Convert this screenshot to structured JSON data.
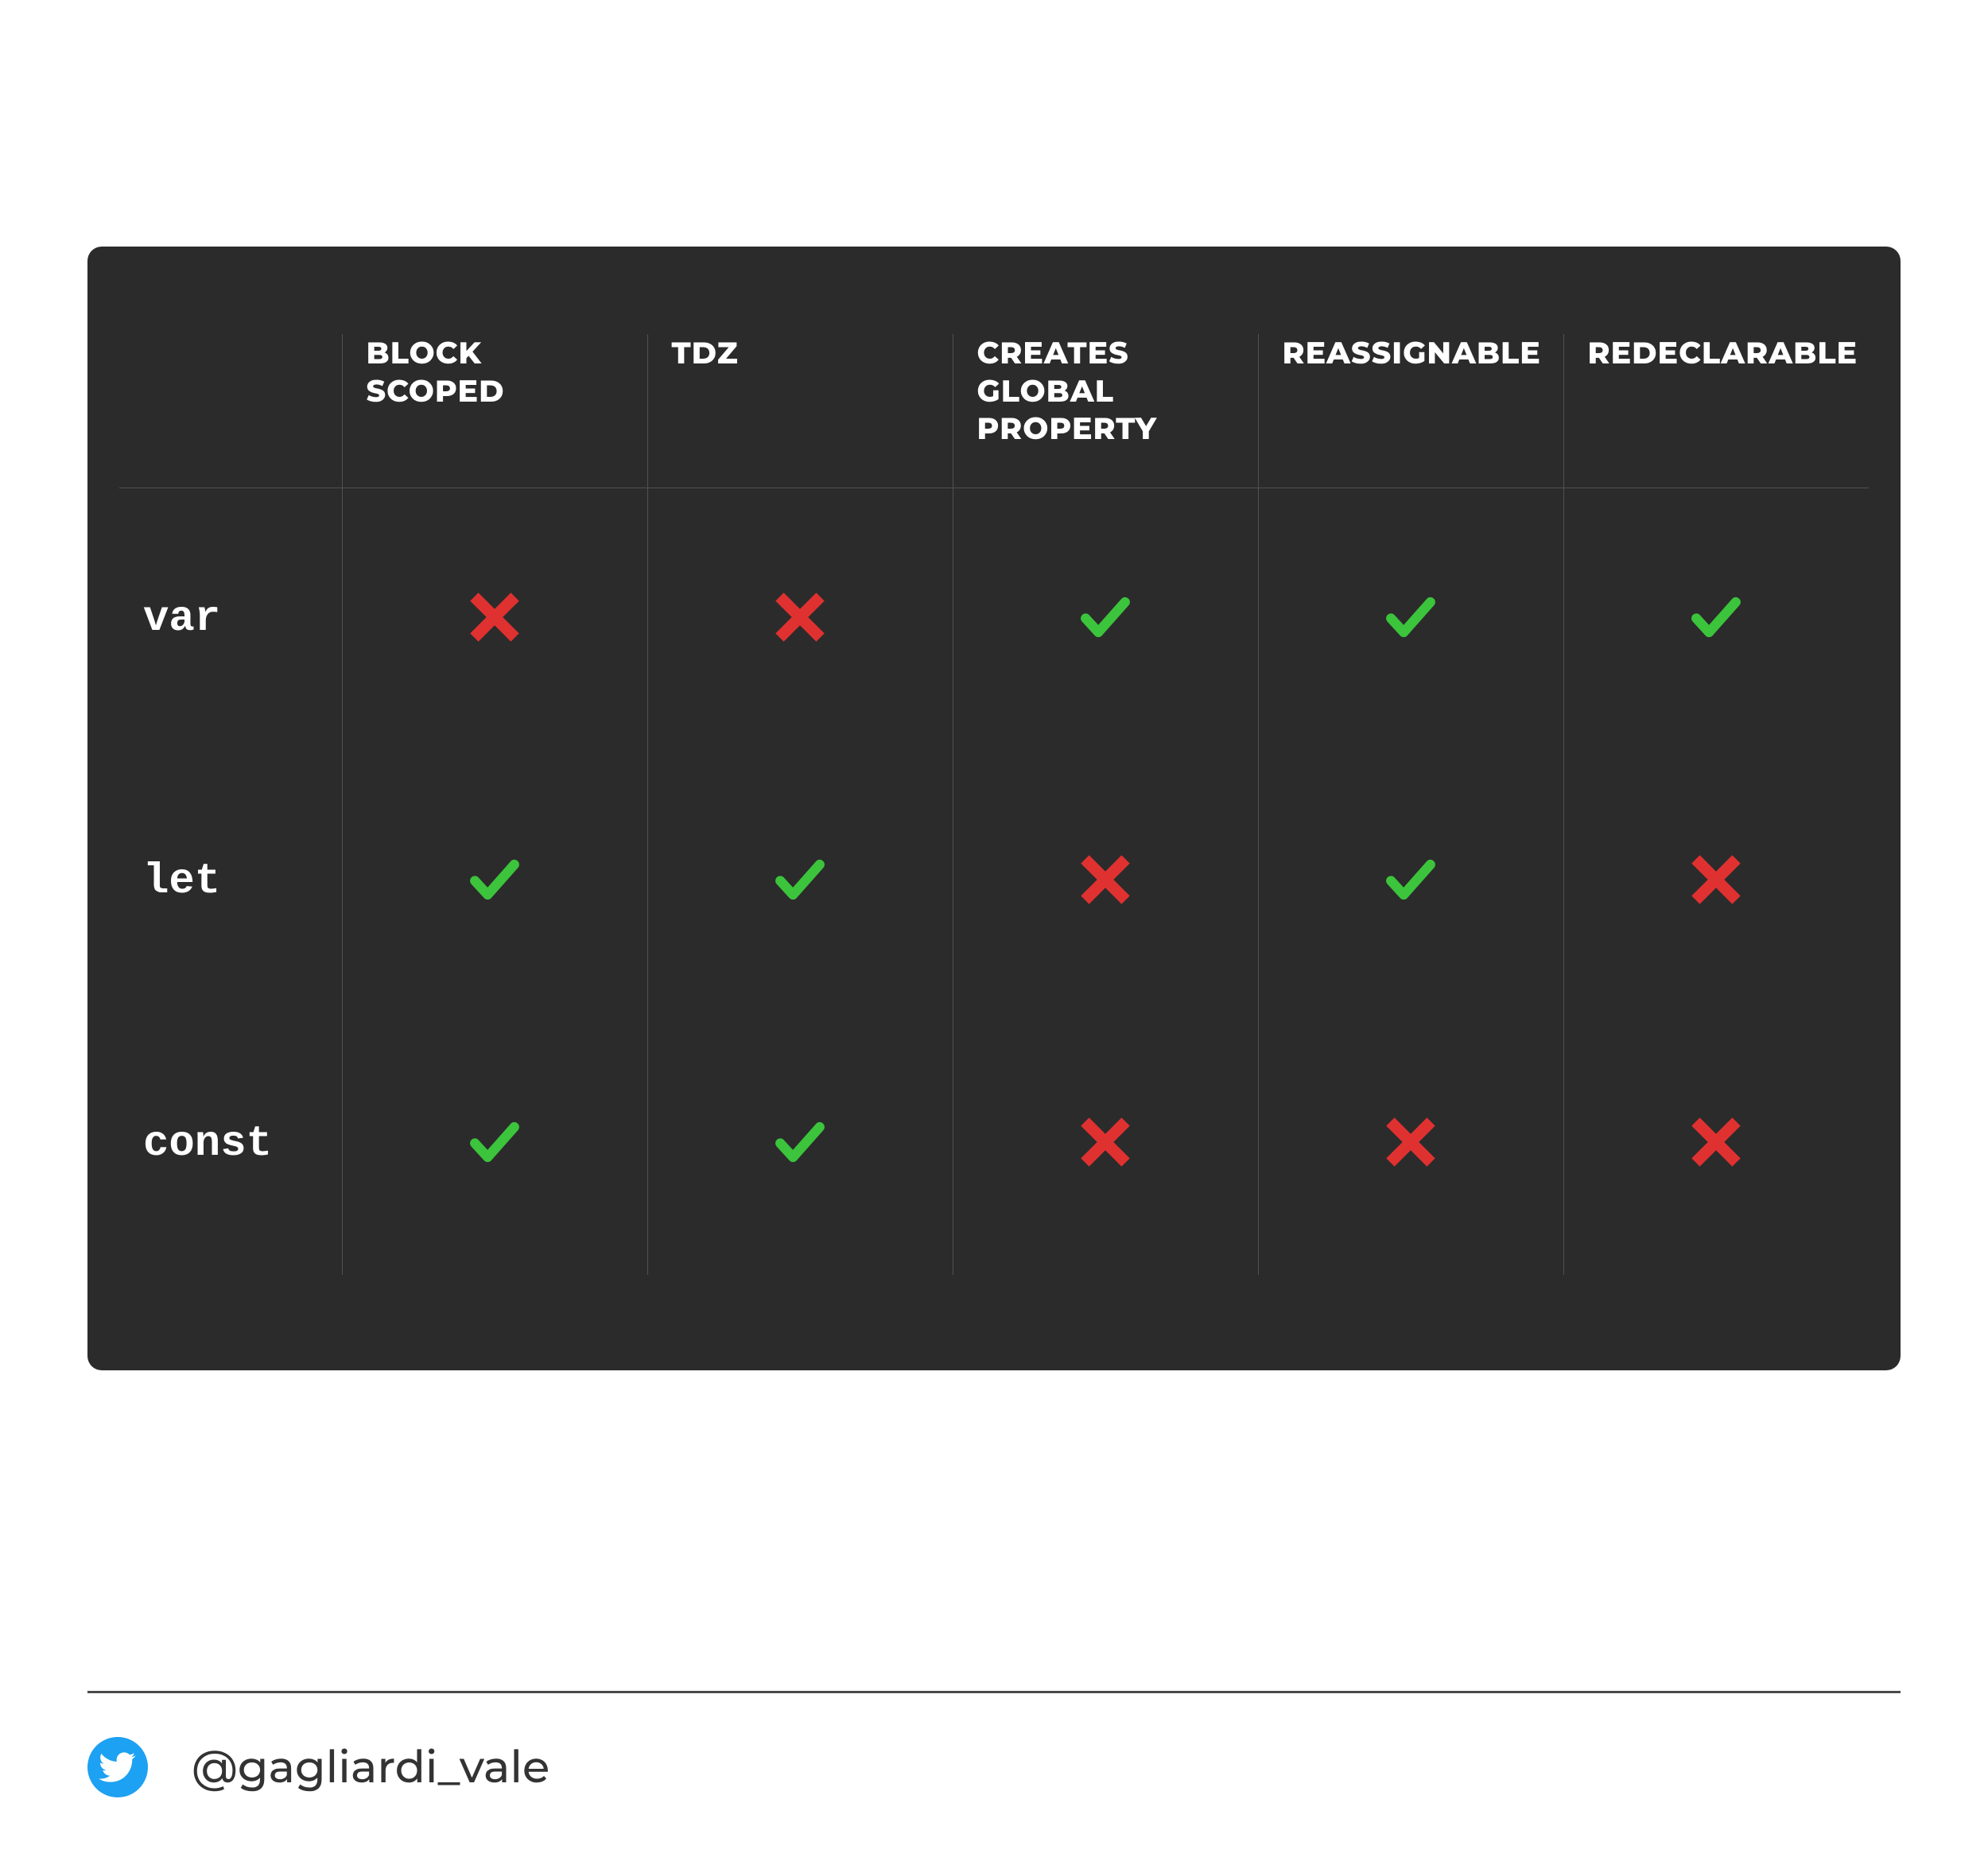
{
  "table": {
    "columns": [
      "BLOCK SCOPED",
      "TDZ",
      "CREATES GLOBAL PROPERTY",
      "REASSIGNABLE",
      "REDECLARABLE"
    ],
    "rows": [
      {
        "label": "var",
        "values": [
          false,
          false,
          true,
          true,
          true
        ]
      },
      {
        "label": "let",
        "values": [
          true,
          true,
          false,
          true,
          false
        ]
      },
      {
        "label": "const",
        "values": [
          true,
          true,
          false,
          false,
          false
        ]
      }
    ]
  },
  "icons": {
    "check_color": "#3cc43c",
    "cross_color": "#e03131"
  },
  "footer": {
    "handle": "@gagliardi_vale"
  }
}
